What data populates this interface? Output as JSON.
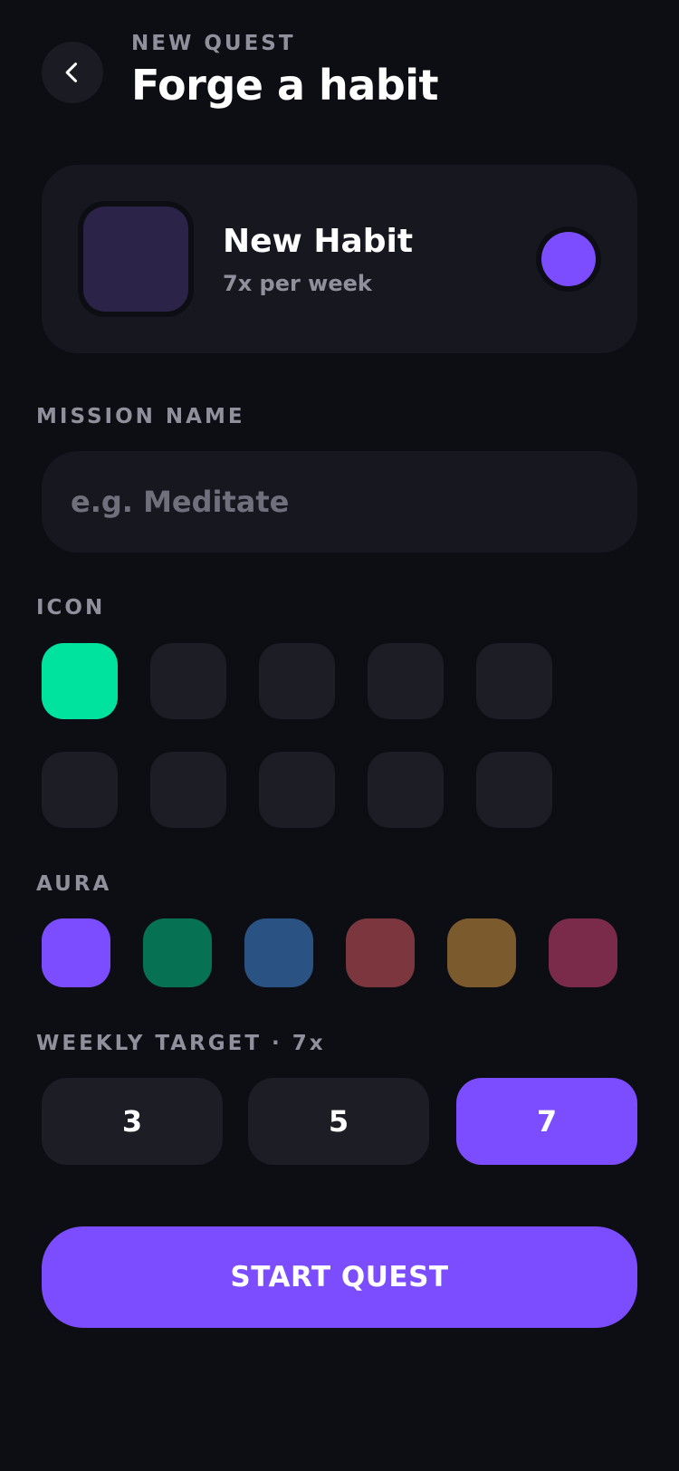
{
  "header": {
    "eyebrow": "NEW QUEST",
    "title": "Forge a habit",
    "back_icon": "chevron-left-icon"
  },
  "preview": {
    "name": "New Habit",
    "frequency": "7x per week",
    "icon_color": "#2b2348",
    "aura_color": "#7c4dff"
  },
  "mission": {
    "label": "MISSION NAME",
    "value": "",
    "placeholder": "e.g. Meditate"
  },
  "icons": {
    "label": "ICON",
    "selected_index": 0,
    "selected_color": "#00e39e",
    "count": 10
  },
  "aura": {
    "label": "AURA",
    "colors": [
      "#7c4dff",
      "#067253",
      "#2a5283",
      "#7b373d",
      "#7b5b2e",
      "#7b2b4a"
    ],
    "selected_index": 0
  },
  "weekly_target": {
    "label": "WEEKLY TARGET · 7x",
    "options": [
      "3",
      "5",
      "7"
    ],
    "selected_index": 2
  },
  "start_button": {
    "label": "START QUEST"
  },
  "colors": {
    "background": "#0d0e13",
    "surface": "#17171f",
    "tile": "#1c1d25",
    "accent": "#7c4dff",
    "muted_text": "#8f909c"
  }
}
